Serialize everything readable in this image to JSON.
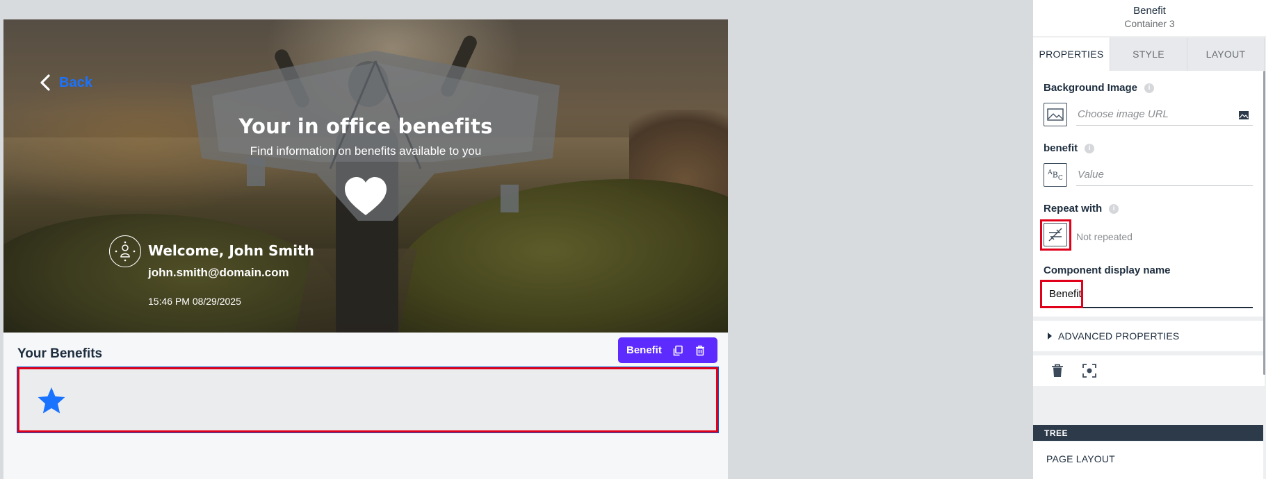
{
  "canvas": {
    "back_label": "Back",
    "hero_title": "Your in office benefits",
    "hero_subtitle": "Find information on benefits available to you",
    "user": {
      "welcome": "Welcome, John Smith",
      "email": "john.smith@domain.com",
      "timestamp": "15:46 PM 08/29/2025"
    },
    "section_title": "Your Benefits",
    "component_toolbar": {
      "label": "Benefit",
      "icons": [
        "copy-icon",
        "trash-icon"
      ]
    },
    "benefit_icon": "star-icon"
  },
  "panel": {
    "title": "Benefit",
    "subtitle": "Container 3",
    "tabs": [
      {
        "label": "PROPERTIES",
        "active": true
      },
      {
        "label": "STYLE",
        "active": false
      },
      {
        "label": "LAYOUT",
        "active": false
      }
    ],
    "background_image": {
      "label": "Background Image",
      "placeholder": "Choose image URL"
    },
    "benefit_field": {
      "label": "benefit",
      "placeholder": "Value"
    },
    "repeat_with": {
      "label": "Repeat with",
      "value": "Not repeated"
    },
    "display_name": {
      "label": "Component display name",
      "value": "Benefit"
    },
    "advanced_label": "ADVANCED PROPERTIES",
    "actions": [
      "trash-icon",
      "focus-icon"
    ],
    "tree": {
      "header": "TREE",
      "item": "PAGE LAYOUT"
    }
  },
  "colors": {
    "accent": "#1a73ff",
    "toolbar": "#5e2bff",
    "highlight": "#e0001a",
    "tree_header": "#2c3a49"
  }
}
